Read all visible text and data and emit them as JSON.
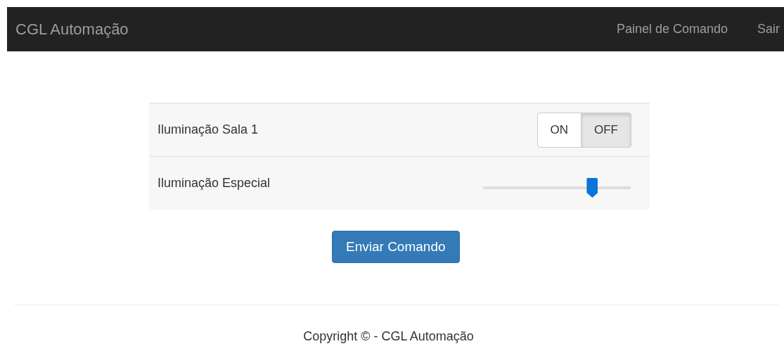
{
  "navbar": {
    "brand": "CGL Automação",
    "links": [
      "Painel de Comando",
      "Sair"
    ]
  },
  "controls": [
    {
      "kind": "toggle",
      "label": "Iluminação Sala 1",
      "options": [
        {
          "label": "ON",
          "selected": false
        },
        {
          "label": "OFF",
          "selected": true
        }
      ]
    },
    {
      "kind": "slider",
      "label": "Iluminação Especial",
      "level": 0.74
    }
  ],
  "submit_button": "Enviar Comando",
  "footer": "Copyright © - CGL Automação"
}
